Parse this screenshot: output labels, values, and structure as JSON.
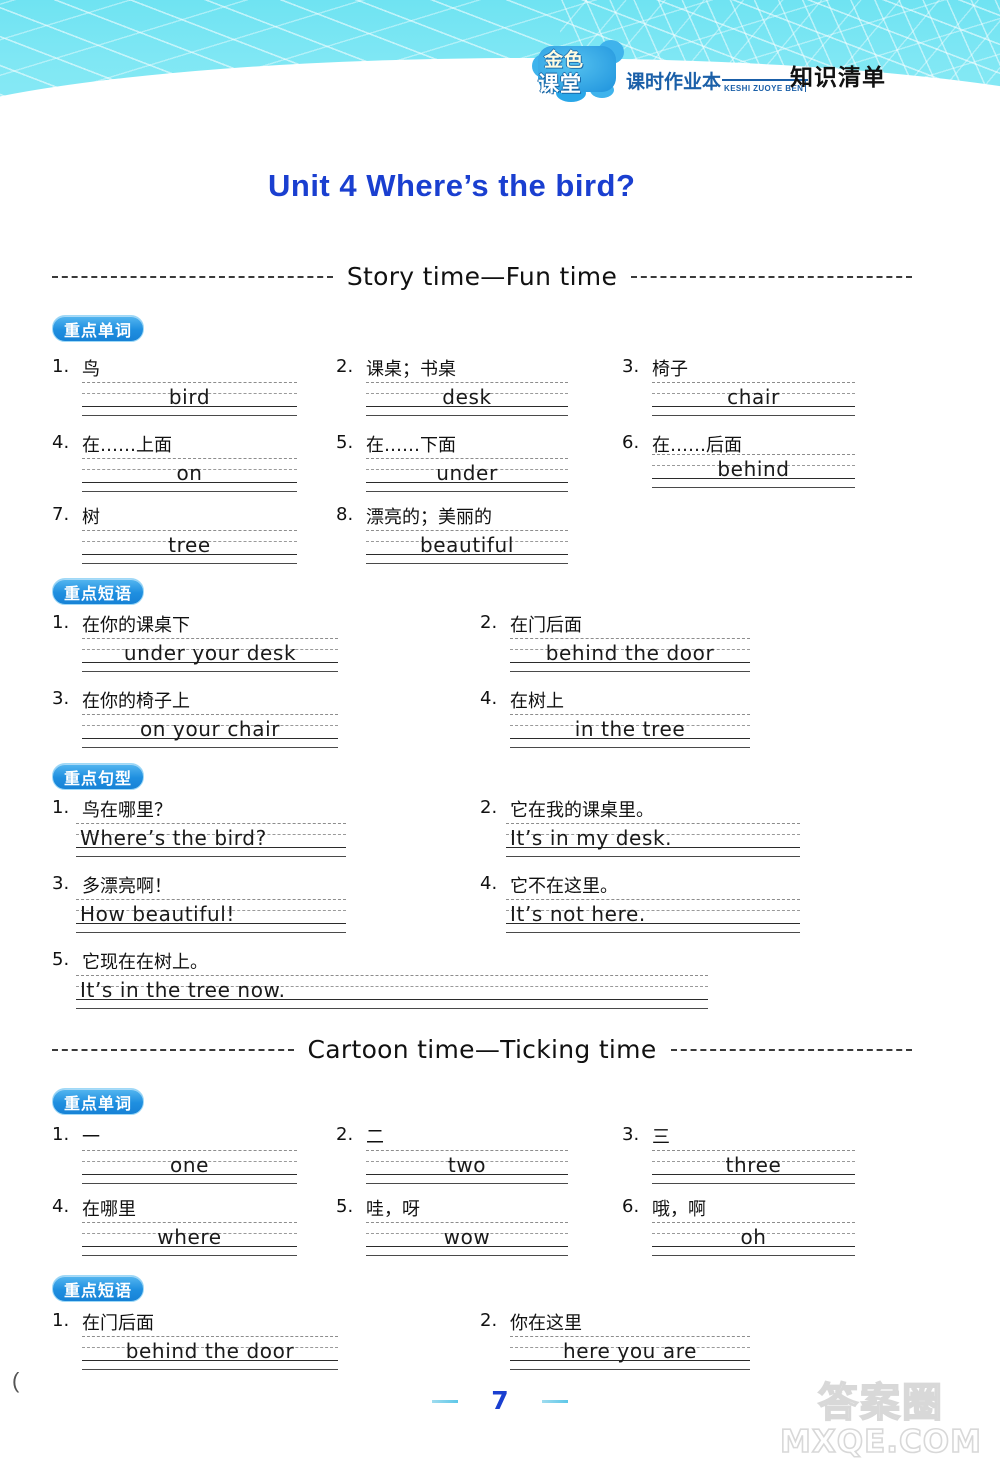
{
  "header": {
    "logo_main_top": "金色",
    "logo_main_bottom": "课堂",
    "logo_sub": "课时作业本",
    "logo_pinyin": "KESHI ZUOYE BEN",
    "title": "知识清单"
  },
  "unit_title": "Unit 4   Where’s the bird?",
  "sections": [
    {
      "divider_label": "Story time—Fun time",
      "groups": [
        {
          "badge": "重点单词",
          "layout": "three-column",
          "items": [
            {
              "num": "1.",
              "cn": "鸟",
              "en": "bird"
            },
            {
              "num": "2.",
              "cn": "课桌；书桌",
              "en": "desk"
            },
            {
              "num": "3.",
              "cn": "椅子",
              "en": "chair"
            },
            {
              "num": "4.",
              "cn": "在……上面",
              "en": "on"
            },
            {
              "num": "5.",
              "cn": "在……下面",
              "en": "under"
            },
            {
              "num": "6.",
              "cn": "在……后面",
              "en": "behind"
            },
            {
              "num": "7.",
              "cn": "树",
              "en": "tree"
            },
            {
              "num": "8.",
              "cn": "漂亮的；美丽的",
              "en": "beautiful"
            }
          ]
        },
        {
          "badge": "重点短语",
          "layout": "two-column",
          "items": [
            {
              "num": "1.",
              "cn": "在你的课桌下",
              "en": "under your desk"
            },
            {
              "num": "2.",
              "cn": "在门后面",
              "en": "behind the door"
            },
            {
              "num": "3.",
              "cn": "在你的椅子上",
              "en": "on your chair"
            },
            {
              "num": "4.",
              "cn": "在树上",
              "en": "in the tree"
            }
          ]
        },
        {
          "badge": "重点句型",
          "layout": "two-column",
          "items": [
            {
              "num": "1.",
              "cn": "鸟在哪里？",
              "en": "Where’s the bird?"
            },
            {
              "num": "2.",
              "cn": "它在我的课桌里。",
              "en": "It’s in my desk."
            },
            {
              "num": "3.",
              "cn": "多漂亮啊！",
              "en": "How beautiful!"
            },
            {
              "num": "4.",
              "cn": "它不在这里。",
              "en": "It’s not here."
            },
            {
              "num": "5.",
              "cn": "它现在在树上。",
              "en": "It’s in the tree now."
            }
          ]
        }
      ]
    },
    {
      "divider_label": "Cartoon time—Ticking time",
      "groups": [
        {
          "badge": "重点单词",
          "layout": "three-column",
          "items": [
            {
              "num": "1.",
              "cn": "一",
              "en": "one"
            },
            {
              "num": "2.",
              "cn": "二",
              "en": "two"
            },
            {
              "num": "3.",
              "cn": "三",
              "en": "three"
            },
            {
              "num": "4.",
              "cn": "在哪里",
              "en": "where"
            },
            {
              "num": "5.",
              "cn": "哇，呀",
              "en": "wow"
            },
            {
              "num": "6.",
              "cn": "哦，啊",
              "en": "oh"
            }
          ]
        },
        {
          "badge": "重点短语",
          "layout": "two-column",
          "items": [
            {
              "num": "1.",
              "cn": "在门后面",
              "en": "behind the door"
            },
            {
              "num": "2.",
              "cn": "你在这里",
              "en": "here you are"
            }
          ]
        }
      ]
    }
  ],
  "footer": {
    "page_number": "7",
    "watermark_line1": "答案圈",
    "watermark_line2": "MXQE.COM",
    "corner_mark": "("
  },
  "colors": {
    "banner": "#7fe7f4",
    "unit_title": "#1a3fd0",
    "badge": "#1f8fe0",
    "ink": "#1a1a1a"
  }
}
